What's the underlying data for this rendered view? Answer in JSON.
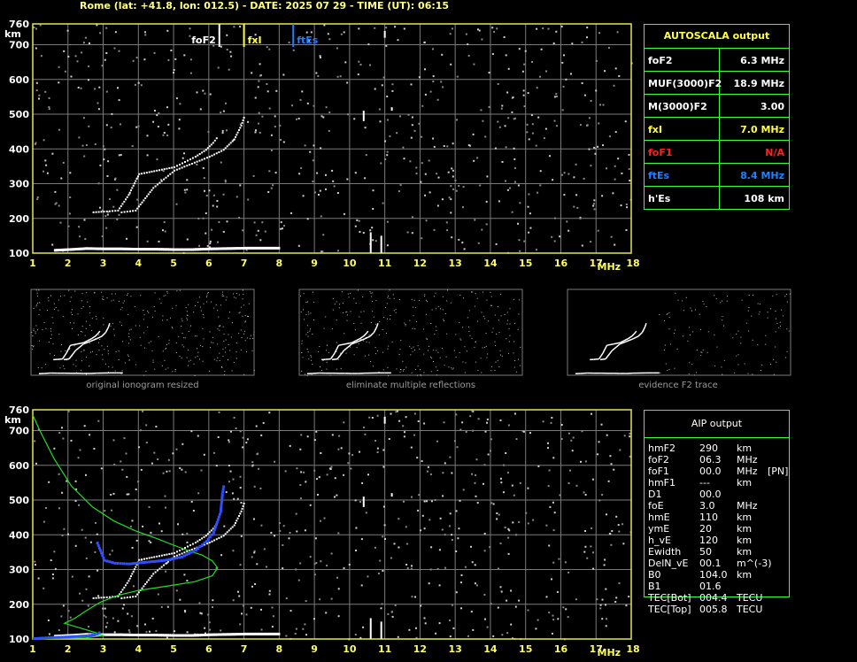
{
  "header": {
    "title": "Rome (lat: +41.8, lon: 012.5) - DATE: 2025 07 29 - TIME (UT): 06:15"
  },
  "autoscala": {
    "title": "AUTOSCALA output",
    "rows": [
      {
        "label": "foF2",
        "value": "6.3 MHz",
        "color": "#ffffff"
      },
      {
        "label": "MUF(3000)F2",
        "value": "18.9 MHz",
        "color": "#ffffff"
      },
      {
        "label": "M(3000)F2",
        "value": "3.00",
        "color": "#ffffff"
      },
      {
        "label": "fxI",
        "value": "7.0 MHz",
        "color": "#ffff40"
      },
      {
        "label": "foF1",
        "value": "N/A",
        "color": "#ff2020"
      },
      {
        "label": "ftEs",
        "value": "8.4 MHz",
        "color": "#2080ff"
      },
      {
        "label": "h'Es",
        "value": "108    km",
        "color": "#ffffff"
      }
    ]
  },
  "aip": {
    "title": "AIP output",
    "rows": [
      {
        "p": "hmF2",
        "v": "290",
        "u": "km",
        "x": ""
      },
      {
        "p": "foF2",
        "v": "06.3",
        "u": "MHz",
        "x": ""
      },
      {
        "p": "foF1",
        "v": "00.0",
        "u": "MHz",
        "x": "[PN]"
      },
      {
        "p": "hmF1",
        "v": "---",
        "u": "km",
        "x": ""
      },
      {
        "p": "D1",
        "v": "00.0",
        "u": "",
        "x": ""
      },
      {
        "p": "foE",
        "v": "3.0",
        "u": "MHz",
        "x": ""
      },
      {
        "p": "hmE",
        "v": "110",
        "u": "km",
        "x": ""
      },
      {
        "p": "ymE",
        "v": "20",
        "u": "km",
        "x": ""
      },
      {
        "p": "h_vE",
        "v": "120",
        "u": "km",
        "x": ""
      },
      {
        "p": "Ewidth",
        "v": "50",
        "u": "km",
        "x": ""
      },
      {
        "p": "DelN_vE",
        "v": "00.1",
        "u": "m^(-3)",
        "x": ""
      },
      {
        "p": "B0",
        "v": "104.0",
        "u": "km",
        "x": ""
      },
      {
        "p": "B1",
        "v": "01.6",
        "u": "",
        "x": ""
      },
      {
        "p": "TEC[Bot]",
        "v": "004.4",
        "u": "TECU",
        "x": ""
      },
      {
        "p": "TEC[Top]",
        "v": "005.8",
        "u": "TECU",
        "x": ""
      }
    ]
  },
  "thumbnails": {
    "captions": [
      "original ionogram resized",
      "eliminate multiple reflections",
      "evidence F2 trace"
    ]
  },
  "chart_data": [
    {
      "type": "scatter",
      "title": "",
      "xlabel": "MHz",
      "ylabel": "km",
      "xlim": [
        1,
        18
      ],
      "ylim": [
        100,
        760
      ],
      "xticks": [
        1,
        2,
        3,
        4,
        5,
        6,
        7,
        8,
        9,
        10,
        11,
        12,
        13,
        14,
        15,
        16,
        17,
        18
      ],
      "yticks": [
        100,
        200,
        300,
        400,
        500,
        600,
        700,
        760
      ],
      "grid": true,
      "markers": [
        {
          "name": "foF2",
          "x": 6.3,
          "color": "#ffffff"
        },
        {
          "name": "fxI",
          "x": 7.0,
          "color": "#ffff40"
        },
        {
          "name": "ftEs",
          "x": 8.4,
          "color": "#2080ff"
        }
      ],
      "traces": {
        "es": [
          [
            1.6,
            112
          ],
          [
            2.0,
            114
          ],
          [
            2.5,
            117
          ],
          [
            3.0,
            116
          ],
          [
            3.5,
            116
          ],
          [
            4.0,
            115
          ],
          [
            4.5,
            115
          ],
          [
            5.0,
            114
          ],
          [
            5.5,
            114
          ],
          [
            6.0,
            116
          ],
          [
            6.5,
            117
          ],
          [
            7.0,
            118
          ],
          [
            7.5,
            118
          ],
          [
            8.0,
            118
          ]
        ],
        "o_trace": [
          [
            2.7,
            220
          ],
          [
            3.0,
            222
          ],
          [
            3.4,
            225
          ],
          [
            3.7,
            270
          ],
          [
            4.0,
            330
          ],
          [
            4.5,
            340
          ],
          [
            5.0,
            350
          ],
          [
            5.3,
            365
          ],
          [
            5.6,
            380
          ],
          [
            5.9,
            400
          ],
          [
            6.1,
            420
          ],
          [
            6.25,
            440
          ]
        ],
        "x_trace": [
          [
            3.5,
            220
          ],
          [
            3.9,
            225
          ],
          [
            4.4,
            290
          ],
          [
            5.0,
            340
          ],
          [
            5.5,
            360
          ],
          [
            6.0,
            380
          ],
          [
            6.4,
            400
          ],
          [
            6.7,
            430
          ],
          [
            6.9,
            470
          ],
          [
            7.0,
            500
          ]
        ],
        "spikes": [
          [
            10.6,
            100,
            160
          ],
          [
            10.9,
            100,
            150
          ],
          [
            10.4,
            480,
            510
          ],
          [
            11.0,
            720,
            740
          ],
          [
            11.2,
            510,
            520
          ]
        ]
      }
    },
    {
      "type": "scatter",
      "title": "",
      "xlabel": "MHz",
      "ylabel": "km",
      "xlim": [
        1,
        18
      ],
      "ylim": [
        100,
        760
      ],
      "xticks": [
        1,
        2,
        3,
        4,
        5,
        6,
        7,
        8,
        9,
        10,
        11,
        12,
        13,
        14,
        15,
        16,
        17,
        18
      ],
      "yticks": [
        100,
        200,
        300,
        400,
        500,
        600,
        700,
        760
      ],
      "grid": true,
      "profile": [
        [
          1.0,
          745
        ],
        [
          1.2,
          700
        ],
        [
          1.6,
          620
        ],
        [
          2.1,
          540
        ],
        [
          2.7,
          480
        ],
        [
          3.3,
          440
        ],
        [
          3.9,
          412
        ],
        [
          4.5,
          390
        ],
        [
          5.0,
          370
        ],
        [
          5.4,
          355
        ],
        [
          5.8,
          342
        ],
        [
          6.1,
          325
        ],
        [
          6.25,
          305
        ],
        [
          6.1,
          282
        ],
        [
          5.6,
          265
        ],
        [
          4.8,
          252
        ],
        [
          4.0,
          240
        ],
        [
          3.4,
          225
        ],
        [
          2.9,
          205
        ],
        [
          2.5,
          180
        ],
        [
          2.2,
          160
        ],
        [
          1.9,
          145
        ],
        [
          2.4,
          130
        ],
        [
          2.8,
          118
        ],
        [
          3.0,
          110
        ],
        [
          2.5,
          103
        ],
        [
          1.0,
          100
        ]
      ],
      "model_trace": [
        [
          2.8,
          380
        ],
        [
          3.0,
          330
        ],
        [
          3.3,
          322
        ],
        [
          3.7,
          320
        ],
        [
          4.2,
          325
        ],
        [
          4.7,
          330
        ],
        [
          5.2,
          340
        ],
        [
          5.6,
          360
        ],
        [
          5.9,
          385
        ],
        [
          6.1,
          410
        ],
        [
          6.2,
          440
        ],
        [
          6.3,
          470
        ],
        [
          6.35,
          520
        ],
        [
          6.4,
          550
        ]
      ],
      "model_es": [
        [
          1.0,
          105
        ],
        [
          1.5,
          108
        ],
        [
          2.0,
          110
        ],
        [
          2.5,
          113
        ],
        [
          2.8,
          118
        ],
        [
          2.9,
          125
        ]
      ]
    }
  ]
}
